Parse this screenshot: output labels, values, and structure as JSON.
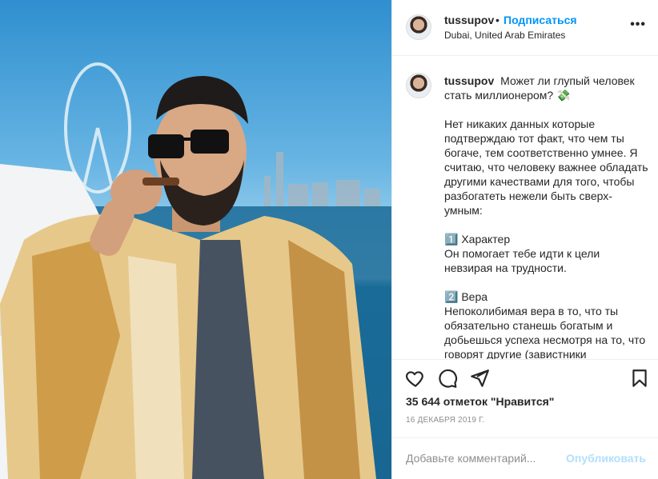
{
  "post": {
    "username": "tussupov",
    "dot": "•",
    "follow_label": "Подписаться",
    "location": "Dubai, United Arab Emirates",
    "more_label": "•••"
  },
  "caption": {
    "username": "tussupov",
    "title": "Может ли глупый человек стать миллионером? 💸",
    "paragraph1": "Нет никаких данных которые подтверждаю тот факт, что чем ты богаче, тем соответственно умнее. Я считаю, что человеку важнее обладать другими качествами для того, чтобы разбогатеть нежели быть сверх-умным:",
    "item1_title": "1️⃣ Характер",
    "item1_text": "Он помогает тебе идти к цели невзирая на трудности.",
    "item2_title": "2️⃣ Вера",
    "item2_text": "Непоколибимая вера в то, что ты обязательно станешь богатым и добьешься успеха несмотря на то, что говорят другие (завистники"
  },
  "actions": {
    "likes_text": "35 644 отметок \"Нравится\"",
    "date": "16 ДЕКАБРЯ 2019 Г.",
    "icons": [
      "heart-icon",
      "comment-icon",
      "share-icon",
      "bookmark-icon"
    ]
  },
  "comment_box": {
    "placeholder": "Добавьте комментарий...",
    "publish_label": "Опубликовать"
  },
  "colors": {
    "accent": "#0095f6",
    "publish_disabled": "#b2dffc",
    "text": "#262626",
    "muted": "#8e8e8e"
  }
}
